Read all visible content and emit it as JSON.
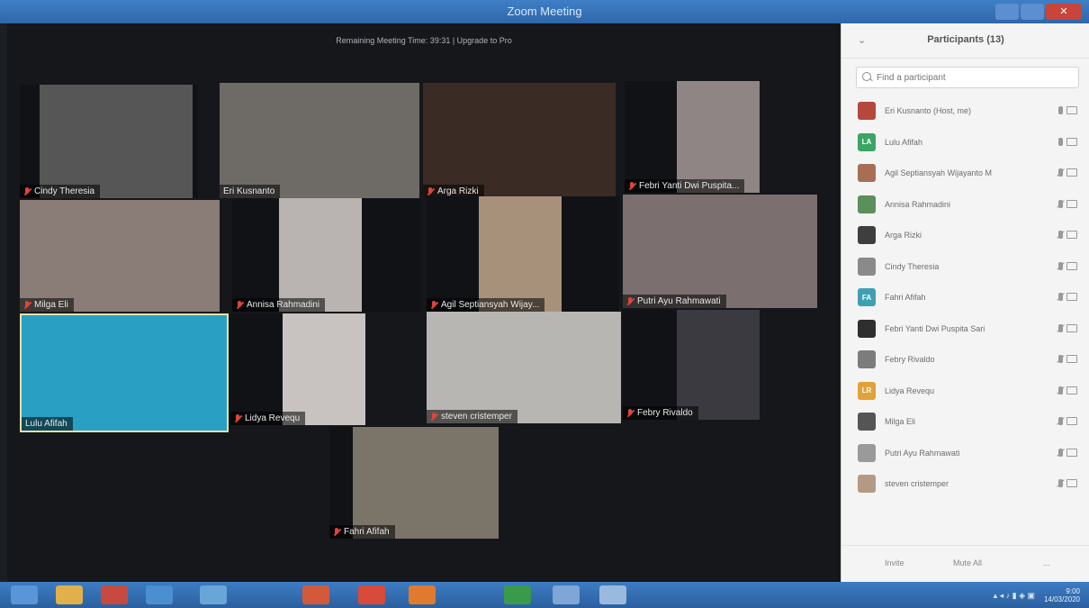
{
  "window": {
    "title": "Zoom Meeting"
  },
  "meeting": {
    "banner": "Remaining Meeting Time: 39:31 | Upgrade to Pro",
    "tiles": [
      {
        "name": "Cindy Theresia",
        "muted": true,
        "bg": "#565656"
      },
      {
        "name": "Eri Kusnanto",
        "muted": false,
        "bg": "#6e6b66"
      },
      {
        "name": "Arga Rizki",
        "muted": true,
        "bg": "#3a2c24"
      },
      {
        "name": "Febri Yanti Dwi Puspita...",
        "muted": true,
        "bg": "#8f8584"
      },
      {
        "name": "Milga Eli",
        "muted": true,
        "bg": "#8a7c77"
      },
      {
        "name": "Annisa Rahmadini",
        "muted": true,
        "bg": "#b9b4b1"
      },
      {
        "name": "Agil Septiansyah Wijay...",
        "muted": true,
        "bg": "#a8917b"
      },
      {
        "name": "Putri Ayu Rahmawati",
        "muted": true,
        "bg": "#7b6f70"
      },
      {
        "name": "Lulu Afifah",
        "muted": false,
        "bg": "#2a9fc4"
      },
      {
        "name": "Lidya Revequ",
        "muted": true,
        "bg": "#c8c3c1"
      },
      {
        "name": "steven cristemper",
        "muted": true,
        "bg": "#b8b6b3"
      },
      {
        "name": "Febry Rivaldo",
        "muted": true,
        "bg": "#3a3a40"
      },
      {
        "name": "Fahri Afifah",
        "muted": true,
        "bg": "#7b7468"
      }
    ]
  },
  "participants": {
    "title": "Participants (13)",
    "collapse_icon": "chevron-down",
    "search_placeholder": "Find a participant",
    "list": [
      {
        "name": "Eri Kusnanto (Host, me)",
        "initials": "",
        "color": "#b5473d",
        "mic": "on"
      },
      {
        "name": "Lulu Afifah",
        "initials": "LA",
        "color": "#3aa564",
        "mic": "on"
      },
      {
        "name": "Agil Septiansyah Wijayanto M",
        "initials": "",
        "color": "#a86e55",
        "mic": "off"
      },
      {
        "name": "Annisa Rahmadini",
        "initials": "",
        "color": "#5c8f5c",
        "mic": "off"
      },
      {
        "name": "Arga Rizki",
        "initials": "",
        "color": "#3e3e3e",
        "mic": "off"
      },
      {
        "name": "Cindy Theresia",
        "initials": "",
        "color": "#8a8a8a",
        "mic": "off"
      },
      {
        "name": "Fahri Afifah",
        "initials": "FA",
        "color": "#3fa0b3",
        "mic": "off"
      },
      {
        "name": "Febri Yanti Dwi Puspita Sari",
        "initials": "",
        "color": "#2e2e2e",
        "mic": "off"
      },
      {
        "name": "Febry Rivaldo",
        "initials": "",
        "color": "#7c7c7c",
        "mic": "off"
      },
      {
        "name": "Lidya Revequ",
        "initials": "LR",
        "color": "#e2a23a",
        "mic": "off"
      },
      {
        "name": "Milga Eli",
        "initials": "",
        "color": "#555555",
        "mic": "off"
      },
      {
        "name": "Putri Ayu Rahmawati",
        "initials": "",
        "color": "#9a9a9a",
        "mic": "off"
      },
      {
        "name": "steven cristemper",
        "initials": "",
        "color": "#b49a85",
        "mic": "off"
      }
    ],
    "footer": {
      "invite": "Invite",
      "mute_all": "Mute All",
      "more": "..."
    }
  },
  "taskbar": {
    "apps": [
      "start",
      "explorer",
      "chrome",
      "files",
      "media",
      "powerpoint",
      "word",
      "excel",
      "zoom",
      "settings",
      "zoom-active"
    ],
    "clock_time": "9:00",
    "clock_date": "14/03/2020"
  }
}
